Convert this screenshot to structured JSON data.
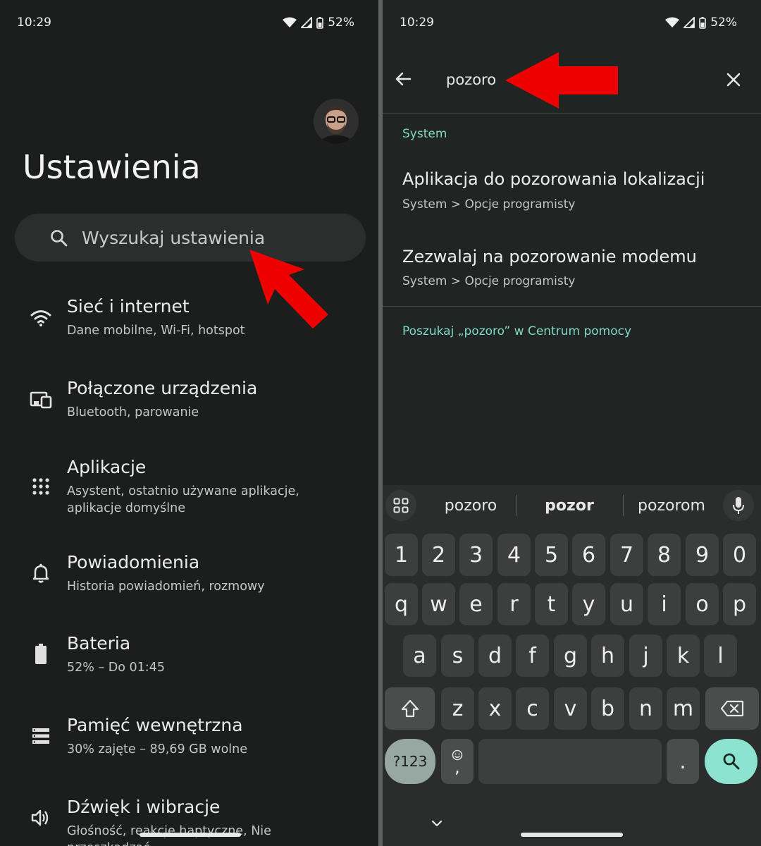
{
  "status": {
    "time": "10:29",
    "battery": "52%"
  },
  "left": {
    "title": "Ustawienia",
    "search_placeholder": "Wyszukaj ustawienia",
    "items": [
      {
        "title": "Sieć i internet",
        "subtitle": "Dane mobilne, Wi-Fi, hotspot",
        "icon": "wifi-icon"
      },
      {
        "title": "Połączone urządzenia",
        "subtitle": "Bluetooth, parowanie",
        "icon": "devices-icon"
      },
      {
        "title": "Aplikacje",
        "subtitle": "Asystent, ostatnio używane aplikacje, aplikacje domyślne",
        "icon": "apps-grid-icon"
      },
      {
        "title": "Powiadomienia",
        "subtitle": "Historia powiadomień, rozmowy",
        "icon": "bell-icon"
      },
      {
        "title": "Bateria",
        "subtitle": "52% – Do 01:45",
        "icon": "battery-icon"
      },
      {
        "title": "Pamięć wewnętrzna",
        "subtitle": "30% zajęte – 89,69 GB wolne",
        "icon": "storage-icon"
      },
      {
        "title": "Dźwięk i wibracje",
        "subtitle": "Głośność, reakcje haptyczne, Nie przeszkadzać",
        "icon": "speaker-icon"
      }
    ]
  },
  "right": {
    "query": "pozoro",
    "section": "System",
    "results": [
      {
        "title": "Aplikacja do pozorowania lokalizacji",
        "path": "System > Opcje programisty"
      },
      {
        "title": "Zezwalaj na pozorowanie modemu",
        "path": "System > Opcje programisty"
      }
    ],
    "help_link": "Poszukaj „pozoro” w Centrum pomocy",
    "keyboard": {
      "suggestions": [
        "pozoro",
        "pozor",
        "pozorom"
      ],
      "row_numbers": [
        "1",
        "2",
        "3",
        "4",
        "5",
        "6",
        "7",
        "8",
        "9",
        "0"
      ],
      "row1": [
        "q",
        "w",
        "e",
        "r",
        "t",
        "y",
        "u",
        "i",
        "o",
        "p"
      ],
      "row2": [
        "a",
        "s",
        "d",
        "f",
        "g",
        "h",
        "j",
        "k",
        "l"
      ],
      "row3": [
        "z",
        "x",
        "c",
        "v",
        "b",
        "n",
        "m"
      ],
      "symbols_label": "?123",
      "emoji_comma": ",",
      "period": "."
    }
  },
  "colors": {
    "accent": "#7fd9c4",
    "arrow": "#ee0000",
    "background": "#1b1e1c"
  }
}
